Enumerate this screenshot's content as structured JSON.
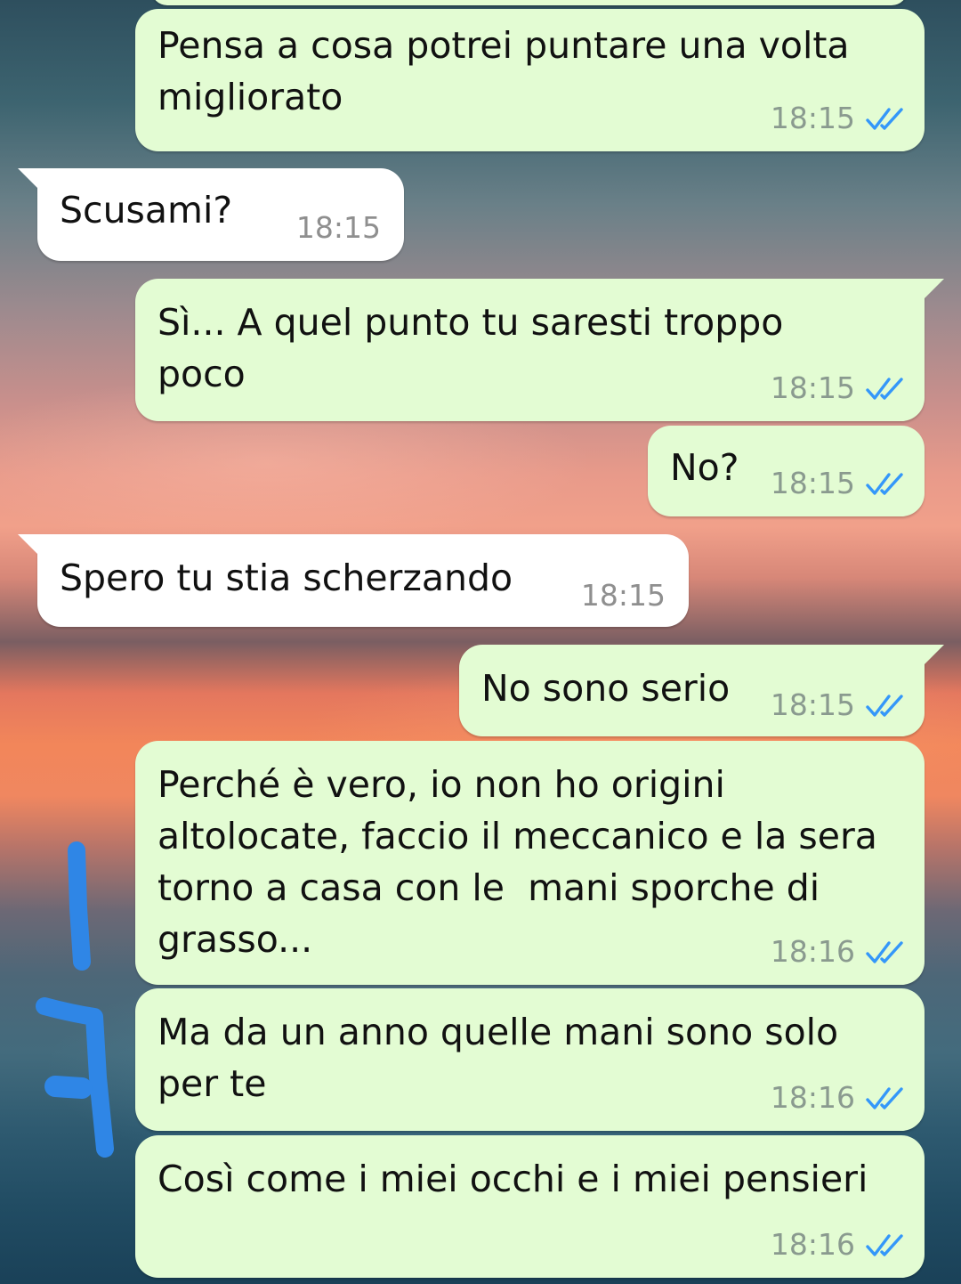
{
  "colors": {
    "outgoing_bubble": "#e3fcd3",
    "incoming_bubble": "#ffffff",
    "read_ticks": "#3497f9",
    "annotation_stroke": "#2f86e6"
  },
  "messages": [
    {
      "direction": "out",
      "text": "Pensa a cosa potrei puntare una volta\nmigliorato",
      "time": "18:15",
      "status_icon": "double-check-read-icon"
    },
    {
      "direction": "in",
      "text": "Scusami?",
      "time": "18:15"
    },
    {
      "direction": "out",
      "text": "Sì... A quel punto tu saresti troppo\npoco",
      "time": "18:15",
      "status_icon": "double-check-read-icon"
    },
    {
      "direction": "out",
      "text": "No?",
      "time": "18:15",
      "status_icon": "double-check-read-icon"
    },
    {
      "direction": "in",
      "text": "Spero tu stia scherzando",
      "time": "18:15"
    },
    {
      "direction": "out",
      "text": "No sono serio",
      "time": "18:15",
      "status_icon": "double-check-read-icon"
    },
    {
      "direction": "out",
      "text": "Perché è vero, io non ho origini\naltolocate, faccio il meccanico e la sera\ntorno a casa con le  mani sporche di\ngrasso...",
      "time": "18:16",
      "status_icon": "double-check-read-icon"
    },
    {
      "direction": "out",
      "text": "Ma da un anno quelle mani sono solo\nper te",
      "time": "18:16",
      "status_icon": "double-check-read-icon"
    },
    {
      "direction": "out",
      "text": "Così come i miei occhi e i miei pensieri",
      "time": "18:16",
      "status_icon": "double-check-read-icon"
    }
  ]
}
